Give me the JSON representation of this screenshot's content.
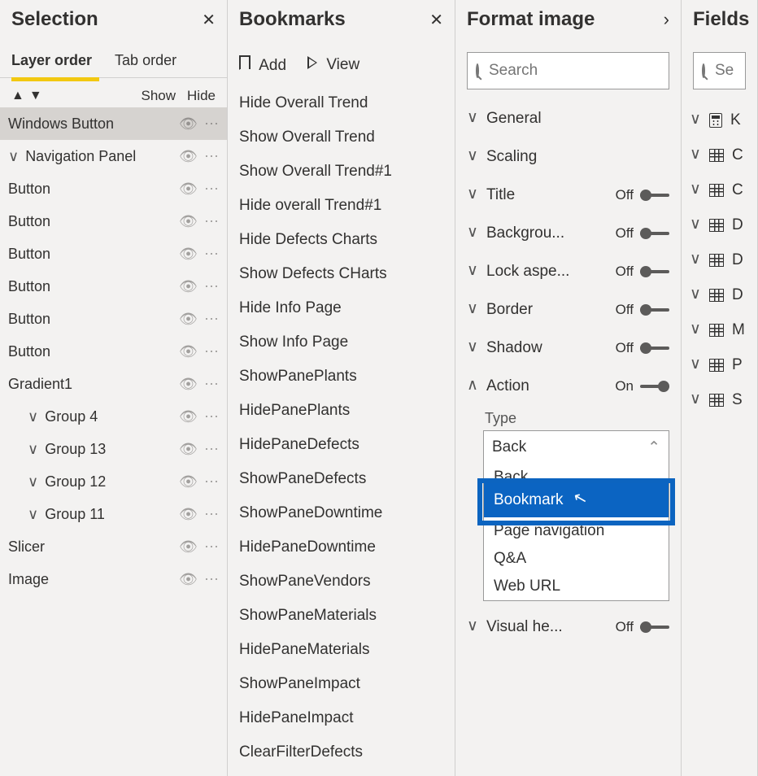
{
  "selection": {
    "title": "Selection",
    "tabs": {
      "layer": "Layer order",
      "tab": "Tab order"
    },
    "toolbar": {
      "show": "Show",
      "hide": "Hide"
    },
    "layers": [
      {
        "name": "Windows Button",
        "indent": 0,
        "chev": false,
        "selected": true
      },
      {
        "name": "Navigation Panel",
        "indent": 0,
        "chev": true
      },
      {
        "name": "Button",
        "indent": 0,
        "chev": false
      },
      {
        "name": "Button",
        "indent": 0,
        "chev": false
      },
      {
        "name": "Button",
        "indent": 0,
        "chev": false
      },
      {
        "name": "Button",
        "indent": 0,
        "chev": false
      },
      {
        "name": "Button",
        "indent": 0,
        "chev": false
      },
      {
        "name": "Button",
        "indent": 0,
        "chev": false
      },
      {
        "name": "Gradient1",
        "indent": 0,
        "chev": false
      },
      {
        "name": "Group 4",
        "indent": 1,
        "chev": true
      },
      {
        "name": "Group 13",
        "indent": 1,
        "chev": true
      },
      {
        "name": "Group 12",
        "indent": 1,
        "chev": true
      },
      {
        "name": "Group 11",
        "indent": 1,
        "chev": true
      },
      {
        "name": "Slicer",
        "indent": 0,
        "chev": false
      },
      {
        "name": "Image",
        "indent": 0,
        "chev": false
      }
    ]
  },
  "bookmarks": {
    "title": "Bookmarks",
    "toolbar": {
      "add": "Add",
      "view": "View"
    },
    "items": [
      "Hide Overall Trend",
      "Show Overall Trend",
      "Show Overall Trend#1",
      "Hide overall Trend#1",
      "Hide Defects Charts",
      "Show Defects CHarts",
      "Hide Info Page",
      "Show Info Page",
      "ShowPanePlants",
      "HidePanePlants",
      "HidePaneDefects",
      "ShowPaneDefects",
      "ShowPaneDowntime",
      "HidePaneDowntime",
      "ShowPaneVendors",
      "ShowPaneMaterials",
      "HidePaneMaterials",
      "ShowPaneImpact",
      "HidePaneImpact",
      "ClearFilterDefects"
    ]
  },
  "format": {
    "title": "Format image",
    "search_placeholder": "Search",
    "sections": [
      {
        "label": "General",
        "expanded": false,
        "toggle": null
      },
      {
        "label": "Scaling",
        "expanded": false,
        "toggle": null
      },
      {
        "label": "Title",
        "expanded": false,
        "toggle": "Off"
      },
      {
        "label": "Backgrou...",
        "expanded": false,
        "toggle": "Off"
      },
      {
        "label": "Lock aspe...",
        "expanded": false,
        "toggle": "Off"
      },
      {
        "label": "Border",
        "expanded": false,
        "toggle": "Off"
      },
      {
        "label": "Shadow",
        "expanded": false,
        "toggle": "Off"
      },
      {
        "label": "Action",
        "expanded": true,
        "toggle": "On"
      },
      {
        "label": "Visual he...",
        "expanded": false,
        "toggle": "Off"
      }
    ],
    "action": {
      "type_label": "Type",
      "selected": "Back",
      "options": [
        "Back",
        "Bookmark",
        "Page navigation",
        "Q&A",
        "Web URL"
      ],
      "highlight_index": 1
    }
  },
  "fields": {
    "title": "Fields",
    "search_placeholder": "Se",
    "tables": [
      {
        "letter": "K",
        "icon": "calc"
      },
      {
        "letter": "C",
        "icon": "table"
      },
      {
        "letter": "C",
        "icon": "table"
      },
      {
        "letter": "D",
        "icon": "table"
      },
      {
        "letter": "D",
        "icon": "table"
      },
      {
        "letter": "D",
        "icon": "table"
      },
      {
        "letter": "M",
        "icon": "table"
      },
      {
        "letter": "P",
        "icon": "table"
      },
      {
        "letter": "S",
        "icon": "table"
      }
    ]
  }
}
